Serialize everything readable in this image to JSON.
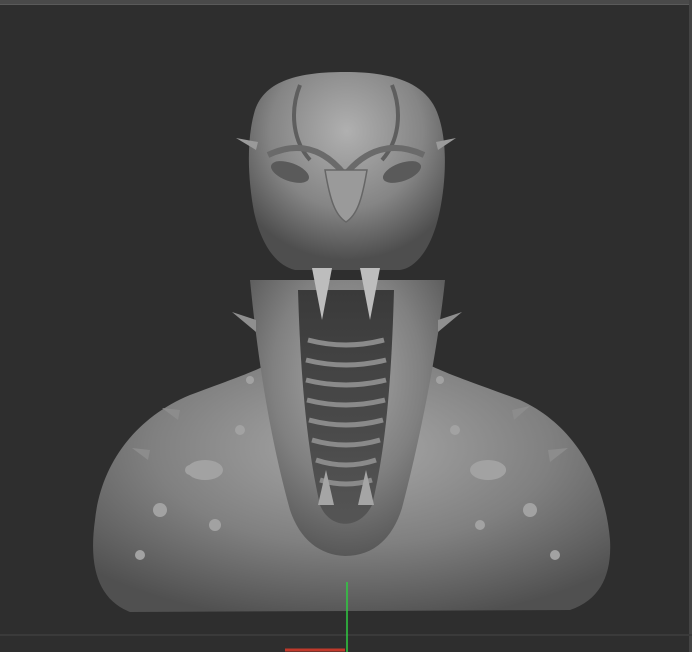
{
  "viewport": {
    "background_color": "#2e2e2e",
    "model_color": "#8a8a8a",
    "axis_y_color": "#2ecc40",
    "axis_x_color": "#c0392b"
  },
  "model": {
    "icon": "creature-bust-sculpt-icon"
  }
}
